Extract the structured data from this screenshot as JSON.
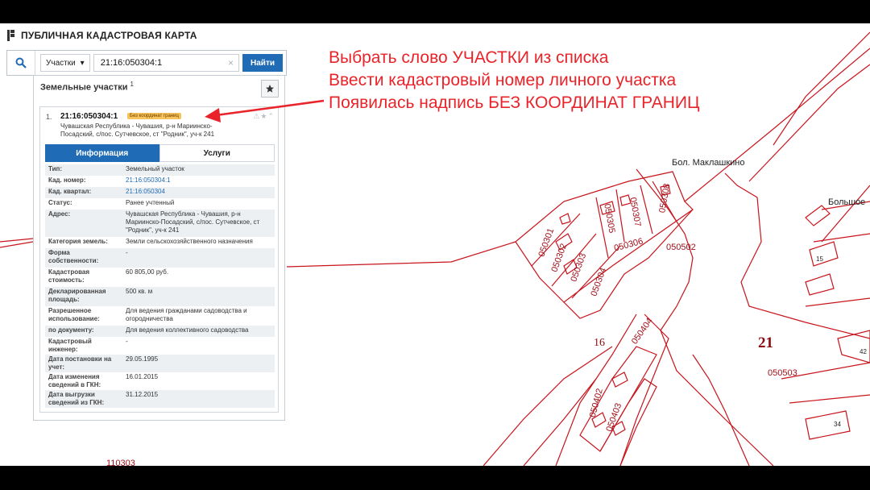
{
  "app": {
    "title": "ПУБЛИЧНАЯ КАДАСТРОВАЯ КАРТА",
    "logo_icon": "rosreestr-logo-icon"
  },
  "search": {
    "icon": "search-icon",
    "type_label": "Участки",
    "type_icon": "caret-down-icon",
    "query": "21:16:050304:1",
    "clear_icon": "clear-icon",
    "find_label": "Найти"
  },
  "results": {
    "heading": "Земельные участки",
    "count": "1",
    "favorite_icon": "star-icon",
    "item": {
      "index": "1.",
      "number": "21:16:050304:1",
      "badge": "Без координат границ",
      "icons": "⚠★⌃",
      "address": "Чувашская Республика - Чувашия, р-н Мариинско-Посадский, с/пос. Сутчевское, ст \"Родник\", уч-к 241"
    },
    "tabs": [
      {
        "label": "Информация",
        "active": true
      },
      {
        "label": "Услуги",
        "active": false
      }
    ],
    "properties": [
      {
        "key": "Тип:",
        "value": "Земельный участок",
        "link": false
      },
      {
        "key": "Кад. номер:",
        "value": "21:16:050304:1",
        "link": true
      },
      {
        "key": "Кад. квартал:",
        "value": "21:16:050304",
        "link": true
      },
      {
        "key": "Статус:",
        "value": "Ранее учтенный",
        "link": false
      },
      {
        "key": "Адрес:",
        "value": "Чувашская Республика - Чувашия, р-н Мариинско-Посадский, с/пос. Сутчевское, ст \"Родник\", уч-к 241",
        "link": false
      },
      {
        "key": "Категория земель:",
        "value": "Земли сельскохозяйственного назначения",
        "link": false
      },
      {
        "key": "Форма собственности:",
        "value": "-",
        "link": false
      },
      {
        "key": "Кадастровая стоимость:",
        "value": "60 805,00 руб.",
        "link": false
      },
      {
        "key": "Декларированная площадь:",
        "value": "500 кв. м",
        "link": false
      },
      {
        "key": "Разрешенное использование:",
        "value": "Для ведения гражданами садоводства и огородничества",
        "link": false
      },
      {
        "key": "по документу:",
        "value": "Для ведения коллективного садоводства",
        "link": false
      },
      {
        "key": "Кадастровый инженер:",
        "value": "-",
        "link": false
      },
      {
        "key": "Дата постановки на учет:",
        "value": "29.05.1995",
        "link": false
      },
      {
        "key": "Дата изменения сведений в ГКН:",
        "value": "16.01.2015",
        "link": false
      },
      {
        "key": "Дата выгрузки сведений из ГКН:",
        "value": "31.12.2015",
        "link": false
      }
    ]
  },
  "instructions": [
    "Выбрать слово УЧАСТКИ из списка",
    "Ввести кадастровый номер личного участка",
    "Появилась надпись БЕЗ КООРДИНАТ ГРАНИЦ"
  ],
  "map": {
    "places": [
      "Бол. Маклашкино",
      "Большое"
    ],
    "districts": [
      "16",
      "21"
    ],
    "quarters": [
      "050301",
      "050302",
      "050303",
      "050304",
      "050305",
      "050306",
      "050307",
      "050308",
      "050502",
      "050503",
      "050404",
      "050402",
      "050403",
      "110303"
    ],
    "numbers": [
      "15",
      "42",
      "34"
    ],
    "line_color": "#c8141c",
    "annotation_color": "#e8242a"
  }
}
